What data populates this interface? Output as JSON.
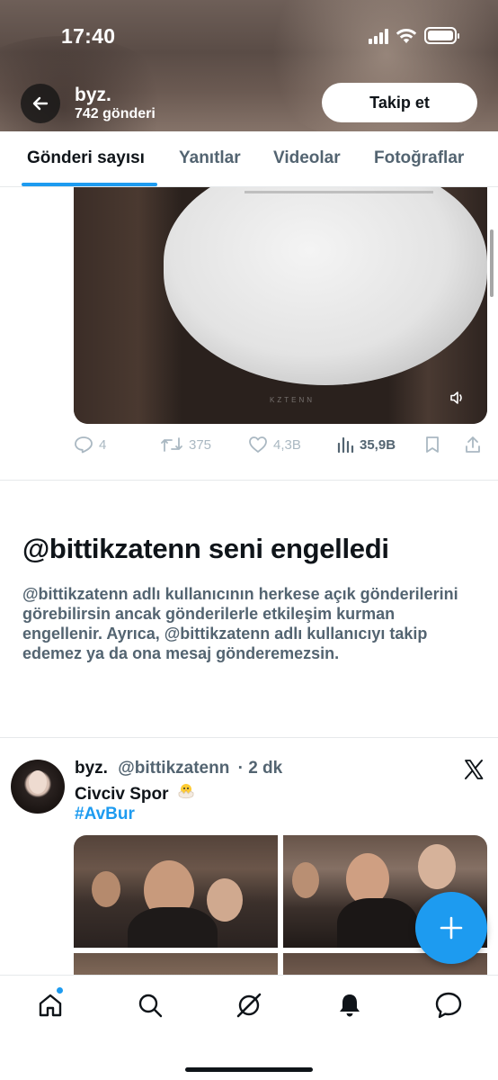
{
  "status_bar": {
    "time": "17:40",
    "icons": [
      "signal-icon",
      "wifi-icon",
      "battery-icon"
    ]
  },
  "header": {
    "name": "byz.",
    "post_count": "742 gönderi",
    "follow_label": "Takip et"
  },
  "tabs": [
    {
      "label": "Gönderi sayısı",
      "active": true
    },
    {
      "label": "Yanıtlar",
      "active": false
    },
    {
      "label": "Videolar",
      "active": false
    },
    {
      "label": "Fotoğraflar",
      "active": false
    }
  ],
  "media_post": {
    "watermark": "KZTENN",
    "replies": "4",
    "reposts": "375",
    "likes": "4,3B",
    "views": "35,9B"
  },
  "blocked": {
    "title": "@bittikzatenn seni engelledi",
    "description": "@bittikzatenn adlı kullanıcının herkese açık gönderilerini görebilirsin ancak gönderilerle etkileşim kurman engellenir. Ayrıca, @bittikzatenn adlı kullanıcıyı takip edemez ya da ona mesaj gönderemezsin."
  },
  "post": {
    "name": "byz.",
    "handle": "@bittikzatenn",
    "time": "· 2 dk",
    "text": "Civciv Spor",
    "emoji": "hatching-chick",
    "hashtag": "#AvBur"
  },
  "colors": {
    "accent": "#1d9bf0",
    "text": "#0f1419",
    "muted": "#536471"
  },
  "bottom_nav": [
    "home-icon",
    "search-icon",
    "grok-icon",
    "notifications-icon",
    "messages-icon"
  ]
}
